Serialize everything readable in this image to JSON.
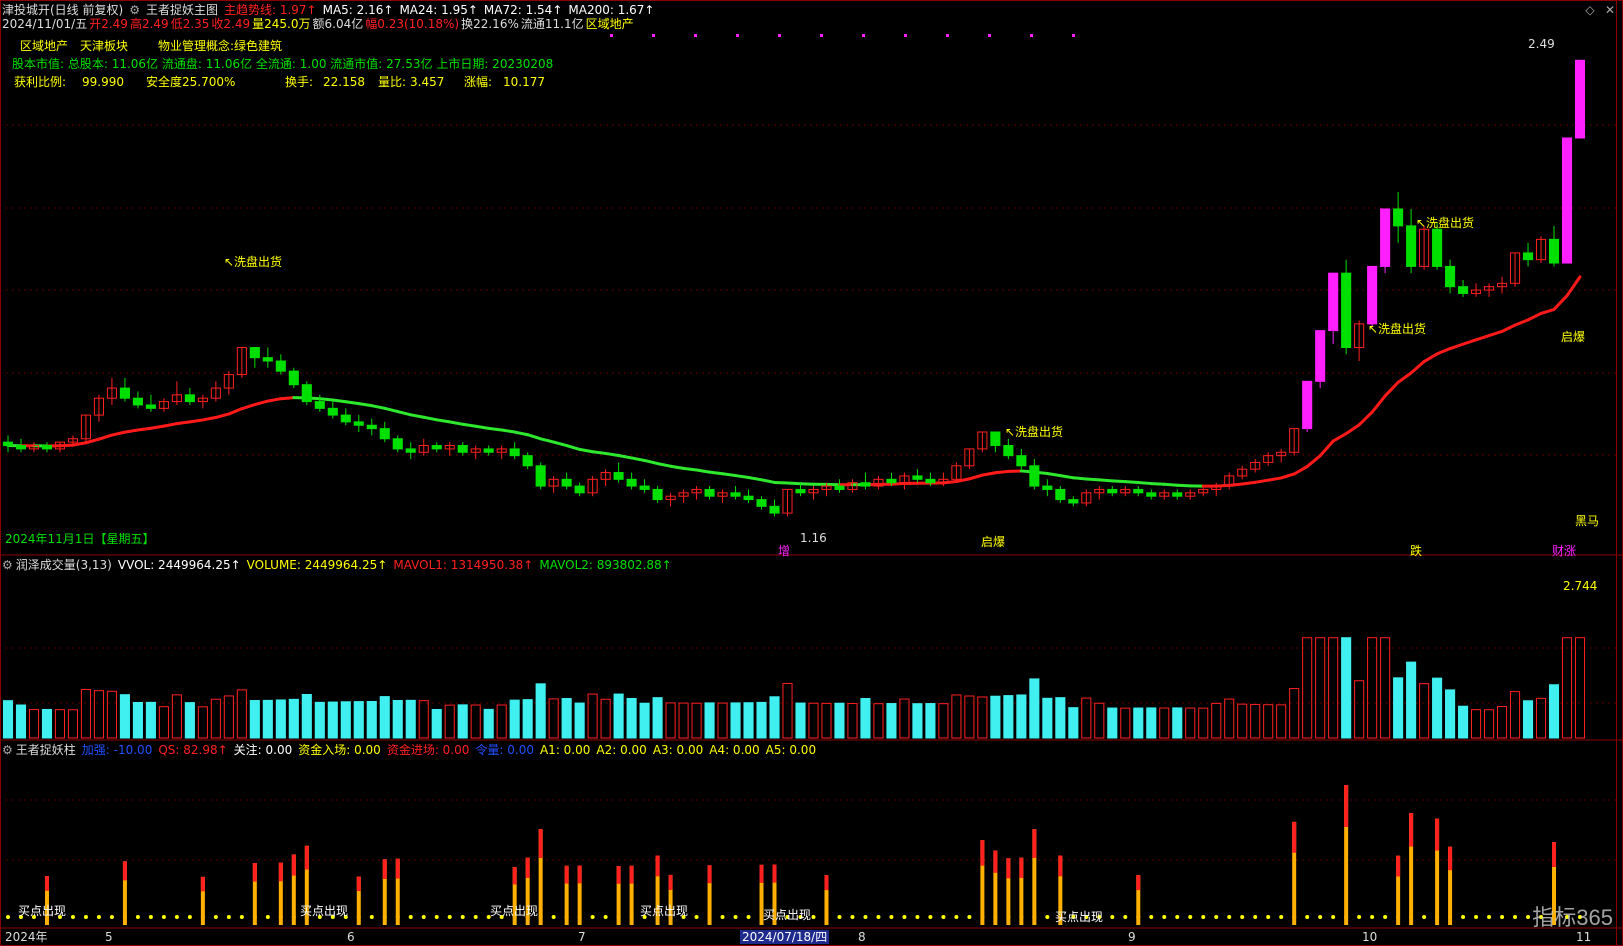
{
  "header": {
    "title": "津投城开(日线 前复权)",
    "indicator_name": "王者捉妖主图",
    "main_trend_label": "主趋势线: 1.97↑",
    "ma5": "MA5: 2.16↑",
    "ma24": "MA24: 1.95↑",
    "ma72": "MA72: 1.54↑",
    "ma200": "MA200: 1.67↑"
  },
  "quote_line": {
    "date": "2024/11/01/五",
    "open": "开2.49",
    "high": "高2.49",
    "low": "低2.35",
    "close": "收2.49",
    "volume": "量245.0万",
    "amount": "额6.04亿",
    "change": "幅0.23(10.18%)",
    "turnover": "换22.16%",
    "float": "流通11.1亿",
    "sector": "区域地产"
  },
  "info_panel": {
    "tags": [
      "区域地产",
      "天津板块",
      "物业管理概念:绿色建筑"
    ],
    "capital_line": "股本市值: 总股本: 11.06亿 流通盘: 11.06亿 全流通: 1.00 流通市值: 27.53亿 上市日期: 20230208",
    "profit_ratio_label": "获利比例:",
    "profit_ratio_value": "99.990",
    "safety_label": "安全度25.700%",
    "turnover_label": "换手:",
    "turnover_value": "22.158",
    "vol_ratio_label": "量比:",
    "vol_ratio_value": "3.457",
    "rise_label": "涨幅:",
    "rise_value": "10.177"
  },
  "main_chart": {
    "date_label": "2024年11月1日【星期五】",
    "high_marker": "2.49",
    "low_marker": "1.16",
    "annotations": [
      "↖洗盘出货",
      "↖洗盘出货",
      "↖洗盘出货",
      "↖洗盘出货"
    ],
    "bottom_labels": [
      "增",
      "启爆",
      "跌",
      "财涨"
    ],
    "right_labels": [
      "启爆",
      "黑马"
    ],
    "colors": {
      "up": "#ff2020",
      "down": "#00e000",
      "trend_up": "#ff1a1a",
      "trend_down": "#2ee82e",
      "magenta": "#ff20ff"
    }
  },
  "volume_panel": {
    "title": "润泽成交量(3,13)",
    "vvol": "VVOL: 2449964.25↑",
    "volume": "VOLUME: 2449964.25↑",
    "mavol1": "MAVOL1: 1314950.38↑",
    "mavol2": "MAVOL2: 893802.88↑",
    "scale_top": "2.744"
  },
  "king_panel": {
    "title": "王者捉妖柱",
    "jiaqiang": "加强: -10.00",
    "qs": "QS: 82.98↑",
    "guanzhu": "关注: 0.00",
    "zijin_ruchang": "资金入场: 0.00",
    "zijin_jinchang": "资金进场: 0.00",
    "jinliang": "令量: 0.00",
    "a1": "A1: 0.00",
    "a2": "A2: 0.00",
    "a3": "A3: 0.00",
    "a4": "A4: 0.00",
    "a5": "A5: 0.00",
    "signal_label": "买点出现"
  },
  "x_axis": {
    "labels": [
      "2024年",
      "5",
      "6",
      "7",
      "2024/07/18/四",
      "8",
      "9",
      "10",
      "11"
    ]
  },
  "watermark": "指标365",
  "chart_data": {
    "type": "candlestick",
    "candles": [
      [
        1.36,
        1.38,
        1.33,
        1.35
      ],
      [
        1.35,
        1.37,
        1.33,
        1.34
      ],
      [
        1.34,
        1.36,
        1.33,
        1.35
      ],
      [
        1.35,
        1.36,
        1.33,
        1.34
      ],
      [
        1.34,
        1.36,
        1.33,
        1.36
      ],
      [
        1.36,
        1.38,
        1.35,
        1.37
      ],
      [
        1.37,
        1.44,
        1.36,
        1.44
      ],
      [
        1.44,
        1.5,
        1.42,
        1.49
      ],
      [
        1.49,
        1.55,
        1.47,
        1.52
      ],
      [
        1.52,
        1.55,
        1.48,
        1.49
      ],
      [
        1.49,
        1.51,
        1.46,
        1.47
      ],
      [
        1.47,
        1.5,
        1.45,
        1.46
      ],
      [
        1.46,
        1.49,
        1.45,
        1.48
      ],
      [
        1.48,
        1.54,
        1.47,
        1.5
      ],
      [
        1.5,
        1.52,
        1.47,
        1.48
      ],
      [
        1.48,
        1.5,
        1.46,
        1.49
      ],
      [
        1.49,
        1.54,
        1.48,
        1.52
      ],
      [
        1.52,
        1.57,
        1.5,
        1.56
      ],
      [
        1.56,
        1.64,
        1.55,
        1.64
      ],
      [
        1.64,
        1.64,
        1.58,
        1.61
      ],
      [
        1.61,
        1.64,
        1.58,
        1.6
      ],
      [
        1.6,
        1.62,
        1.56,
        1.57
      ],
      [
        1.57,
        1.58,
        1.52,
        1.53
      ],
      [
        1.53,
        1.54,
        1.47,
        1.48
      ],
      [
        1.48,
        1.5,
        1.45,
        1.46
      ],
      [
        1.46,
        1.48,
        1.43,
        1.44
      ],
      [
        1.44,
        1.46,
        1.41,
        1.42
      ],
      [
        1.42,
        1.44,
        1.39,
        1.41
      ],
      [
        1.41,
        1.43,
        1.38,
        1.4
      ],
      [
        1.4,
        1.42,
        1.36,
        1.37
      ],
      [
        1.37,
        1.38,
        1.33,
        1.34
      ],
      [
        1.34,
        1.36,
        1.31,
        1.33
      ],
      [
        1.33,
        1.37,
        1.32,
        1.35
      ],
      [
        1.35,
        1.36,
        1.33,
        1.34
      ],
      [
        1.34,
        1.36,
        1.32,
        1.35
      ],
      [
        1.35,
        1.36,
        1.32,
        1.33
      ],
      [
        1.33,
        1.35,
        1.31,
        1.34
      ],
      [
        1.34,
        1.35,
        1.32,
        1.33
      ],
      [
        1.33,
        1.35,
        1.31,
        1.34
      ],
      [
        1.34,
        1.36,
        1.31,
        1.32
      ],
      [
        1.32,
        1.33,
        1.28,
        1.29
      ],
      [
        1.29,
        1.3,
        1.22,
        1.23
      ],
      [
        1.23,
        1.26,
        1.21,
        1.25
      ],
      [
        1.25,
        1.27,
        1.22,
        1.23
      ],
      [
        1.23,
        1.24,
        1.2,
        1.21
      ],
      [
        1.21,
        1.26,
        1.2,
        1.25
      ],
      [
        1.25,
        1.28,
        1.23,
        1.27
      ],
      [
        1.27,
        1.3,
        1.24,
        1.25
      ],
      [
        1.25,
        1.27,
        1.22,
        1.23
      ],
      [
        1.23,
        1.25,
        1.21,
        1.22
      ],
      [
        1.22,
        1.23,
        1.18,
        1.19
      ],
      [
        1.19,
        1.21,
        1.17,
        1.2
      ],
      [
        1.2,
        1.22,
        1.18,
        1.21
      ],
      [
        1.21,
        1.23,
        1.19,
        1.22
      ],
      [
        1.22,
        1.23,
        1.19,
        1.2
      ],
      [
        1.2,
        1.22,
        1.18,
        1.21
      ],
      [
        1.21,
        1.23,
        1.19,
        1.2
      ],
      [
        1.2,
        1.22,
        1.18,
        1.19
      ],
      [
        1.19,
        1.2,
        1.16,
        1.17
      ],
      [
        1.17,
        1.19,
        1.14,
        1.15
      ],
      [
        1.15,
        1.22,
        1.14,
        1.22
      ],
      [
        1.22,
        1.24,
        1.2,
        1.21
      ],
      [
        1.21,
        1.23,
        1.19,
        1.22
      ],
      [
        1.22,
        1.24,
        1.2,
        1.23
      ],
      [
        1.23,
        1.25,
        1.21,
        1.22
      ],
      [
        1.22,
        1.25,
        1.21,
        1.24
      ],
      [
        1.24,
        1.27,
        1.22,
        1.23
      ],
      [
        1.23,
        1.26,
        1.22,
        1.25
      ],
      [
        1.25,
        1.27,
        1.23,
        1.24
      ],
      [
        1.24,
        1.27,
        1.22,
        1.26
      ],
      [
        1.26,
        1.28,
        1.24,
        1.25
      ],
      [
        1.25,
        1.27,
        1.23,
        1.24
      ],
      [
        1.24,
        1.27,
        1.23,
        1.25
      ],
      [
        1.25,
        1.3,
        1.24,
        1.29
      ],
      [
        1.29,
        1.34,
        1.28,
        1.34
      ],
      [
        1.34,
        1.39,
        1.33,
        1.39
      ],
      [
        1.39,
        1.39,
        1.33,
        1.35
      ],
      [
        1.35,
        1.37,
        1.31,
        1.32
      ],
      [
        1.32,
        1.34,
        1.28,
        1.29
      ],
      [
        1.29,
        1.31,
        1.22,
        1.23
      ],
      [
        1.23,
        1.25,
        1.2,
        1.22
      ],
      [
        1.22,
        1.23,
        1.18,
        1.19
      ],
      [
        1.19,
        1.2,
        1.17,
        1.18
      ],
      [
        1.18,
        1.22,
        1.17,
        1.21
      ],
      [
        1.21,
        1.23,
        1.19,
        1.22
      ],
      [
        1.22,
        1.23,
        1.2,
        1.21
      ],
      [
        1.21,
        1.23,
        1.2,
        1.22
      ],
      [
        1.22,
        1.23,
        1.2,
        1.21
      ],
      [
        1.21,
        1.22,
        1.19,
        1.2
      ],
      [
        1.2,
        1.22,
        1.19,
        1.21
      ],
      [
        1.21,
        1.22,
        1.19,
        1.2
      ],
      [
        1.2,
        1.22,
        1.19,
        1.21
      ],
      [
        1.21,
        1.23,
        1.2,
        1.22
      ],
      [
        1.22,
        1.24,
        1.2,
        1.23
      ],
      [
        1.23,
        1.27,
        1.22,
        1.26
      ],
      [
        1.26,
        1.29,
        1.25,
        1.28
      ],
      [
        1.28,
        1.31,
        1.27,
        1.3
      ],
      [
        1.3,
        1.33,
        1.29,
        1.32
      ],
      [
        1.32,
        1.34,
        1.3,
        1.33
      ],
      [
        1.33,
        1.4,
        1.32,
        1.4
      ],
      [
        1.4,
        1.54,
        1.39,
        1.54
      ],
      [
        1.54,
        1.69,
        1.52,
        1.69
      ],
      [
        1.69,
        1.86,
        1.65,
        1.86
      ],
      [
        1.86,
        1.9,
        1.62,
        1.64
      ],
      [
        1.64,
        1.72,
        1.6,
        1.71
      ],
      [
        1.71,
        1.88,
        1.7,
        1.88
      ],
      [
        1.88,
        2.05,
        1.86,
        2.05
      ],
      [
        2.05,
        2.1,
        1.95,
        2.0
      ],
      [
        2.0,
        2.05,
        1.86,
        1.88
      ],
      [
        1.88,
        2.0,
        1.87,
        1.99
      ],
      [
        1.99,
        2.01,
        1.87,
        1.88
      ],
      [
        1.88,
        1.9,
        1.8,
        1.82
      ],
      [
        1.82,
        1.84,
        1.79,
        1.8
      ],
      [
        1.8,
        1.83,
        1.79,
        1.81
      ],
      [
        1.81,
        1.83,
        1.79,
        1.82
      ],
      [
        1.82,
        1.85,
        1.8,
        1.83
      ],
      [
        1.83,
        1.92,
        1.82,
        1.92
      ],
      [
        1.92,
        1.95,
        1.88,
        1.9
      ],
      [
        1.9,
        1.97,
        1.89,
        1.96
      ],
      [
        1.96,
        2.0,
        1.88,
        1.89
      ],
      [
        1.89,
        2.26,
        1.89,
        2.26
      ],
      [
        2.26,
        2.49,
        2.26,
        2.49
      ]
    ],
    "title": "津投城开(日线 前复权)",
    "ylabel": "",
    "ylim": [
      1.1,
      2.55
    ],
    "x_ticks": [
      "2024年",
      "5",
      "6",
      "7",
      "8",
      "9",
      "10",
      "11"
    ]
  }
}
